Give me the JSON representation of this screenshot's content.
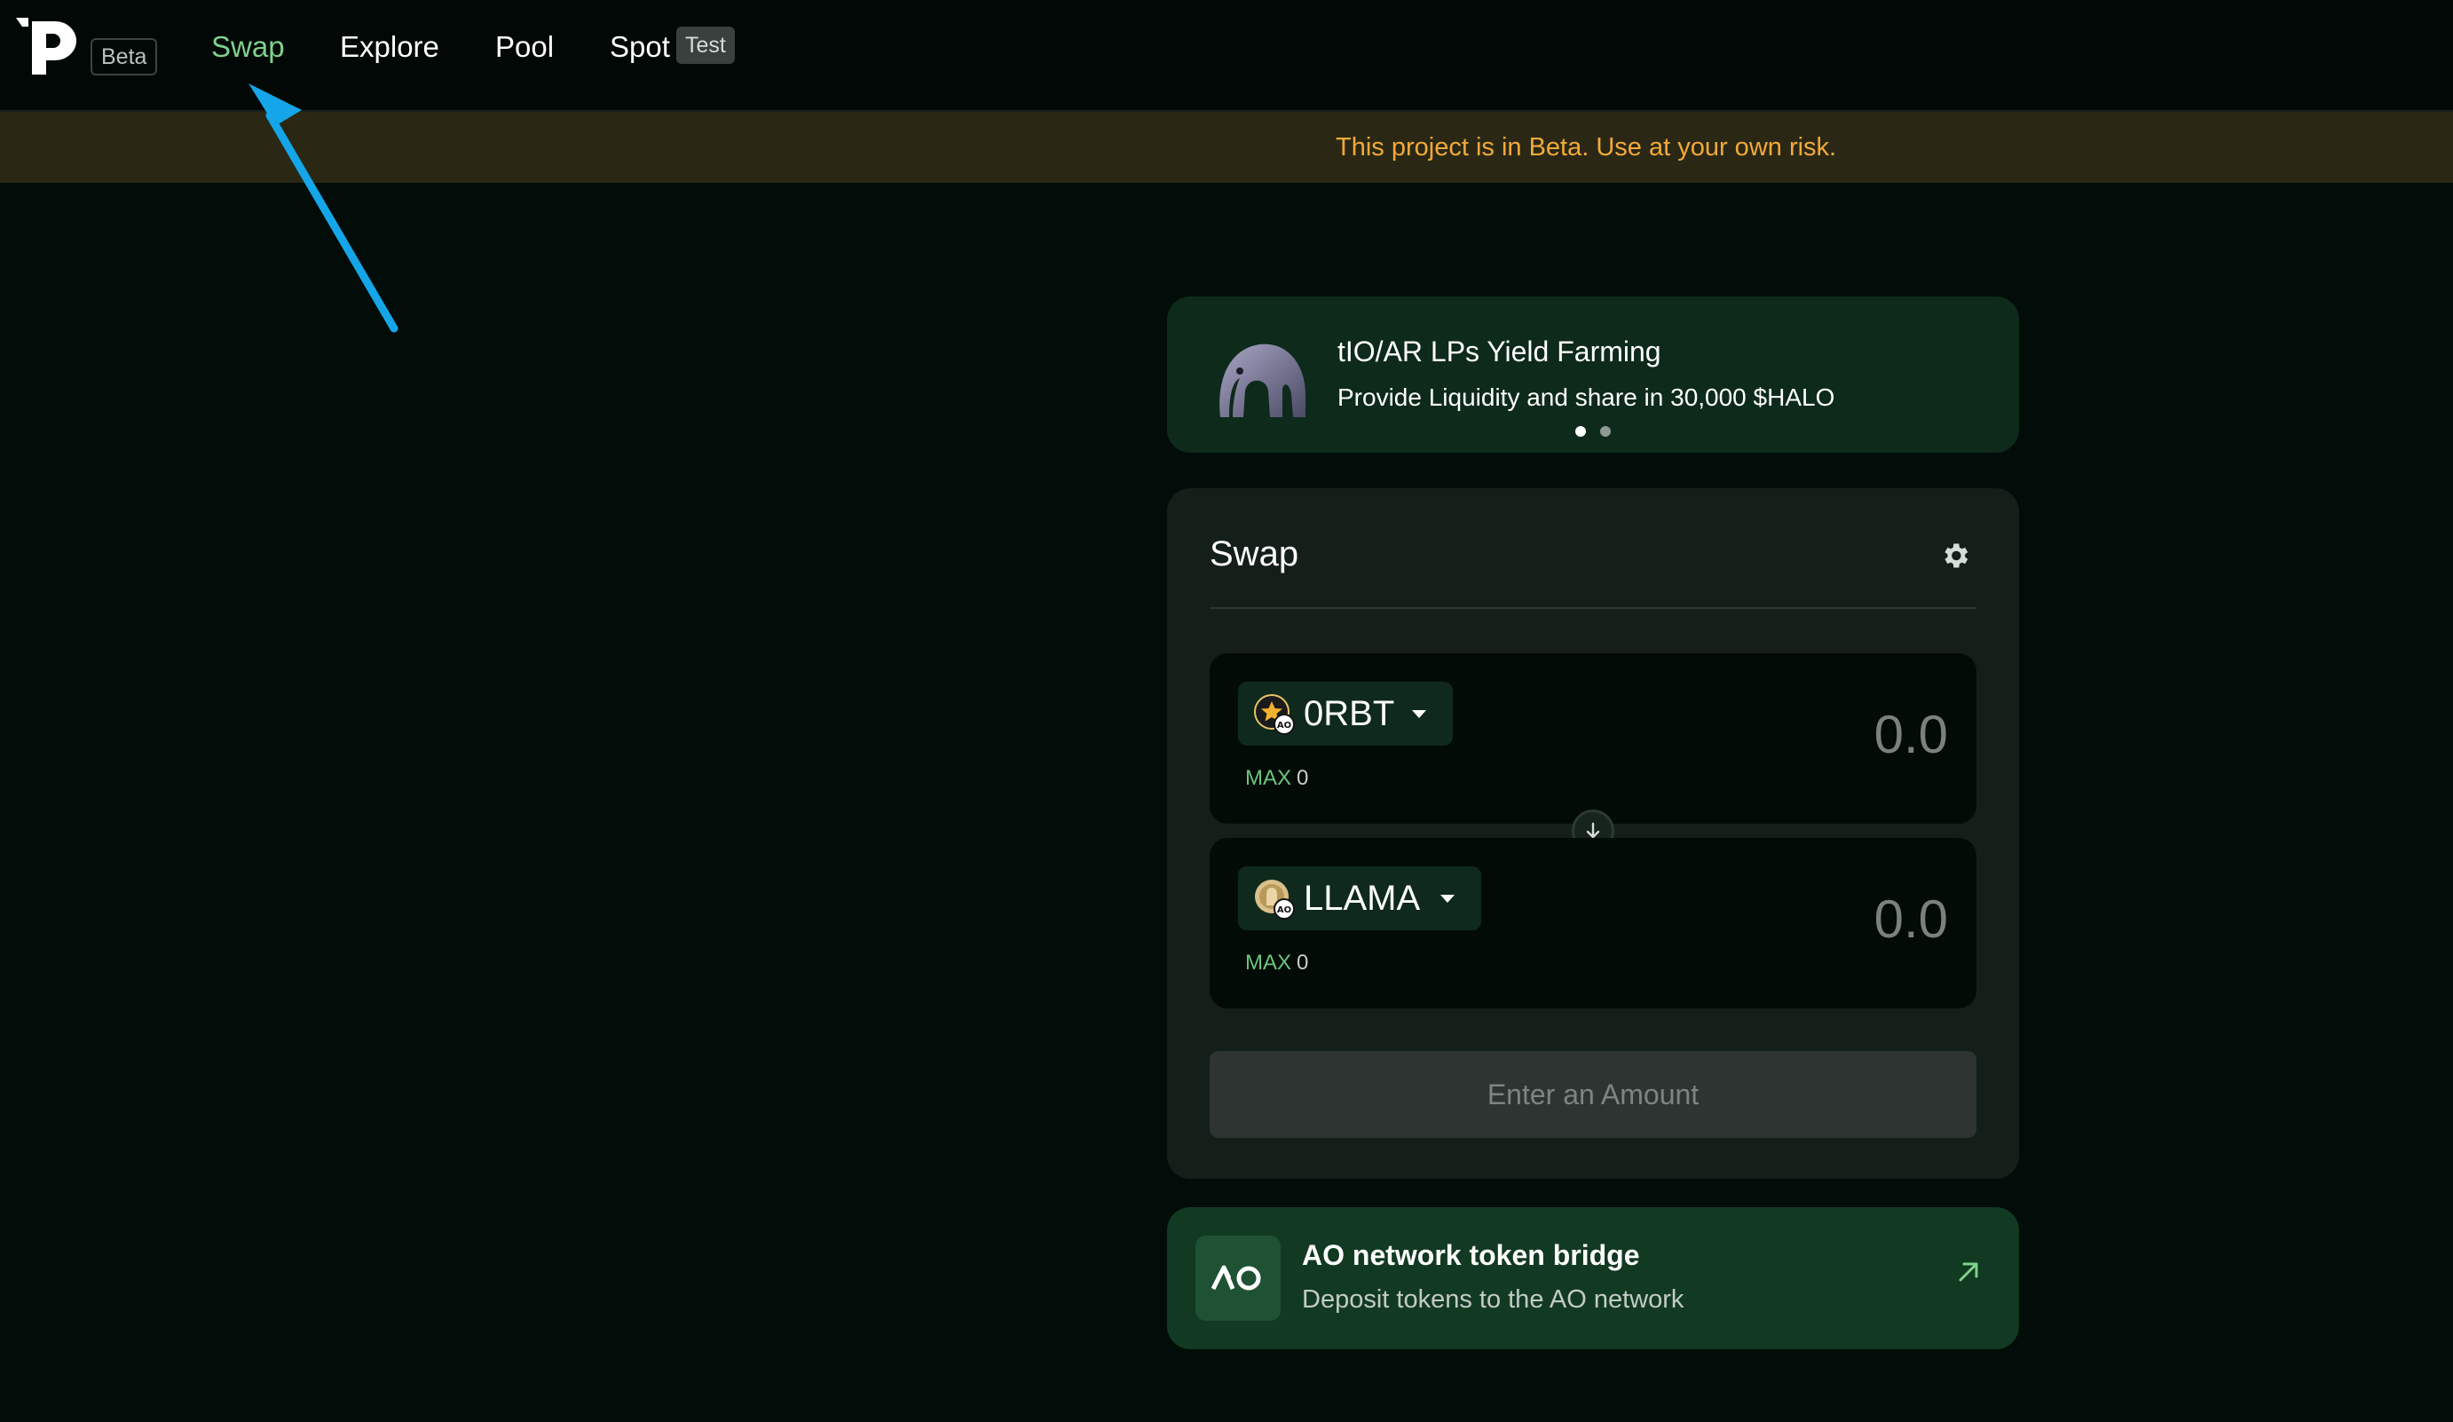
{
  "nav": {
    "logo": "p",
    "beta_badge": "Beta",
    "items": [
      {
        "label": "Swap",
        "active": true
      },
      {
        "label": "Explore",
        "active": false
      },
      {
        "label": "Pool",
        "active": false
      },
      {
        "label": "Spot",
        "active": false
      }
    ],
    "spot_badge": "Test"
  },
  "banner": {
    "text": "This project is in Beta. Use at your own risk."
  },
  "promo": {
    "title": "tIO/AR LPs Yield Farming",
    "subtitle": "Provide Liquidity and share in 30,000 $HALO",
    "carousel_active_index": 0,
    "carousel_count": 2
  },
  "swap": {
    "title": "Swap",
    "settings_icon": "gear-icon",
    "from": {
      "token": "0RBT",
      "max_label": "MAX",
      "max_value": "0",
      "amount": "0.0"
    },
    "to": {
      "token": "LLAMA",
      "max_label": "MAX",
      "max_value": "0",
      "amount": "0.0"
    },
    "flip_icon": "arrow-down-icon",
    "submit_label": "Enter an Amount"
  },
  "bridge": {
    "logo": "AO",
    "title": "AO network token bridge",
    "subtitle": "Deposit tokens to the AO network",
    "icon": "external-link-icon"
  },
  "colors": {
    "background": "#020c08",
    "accent_green": "#7fd18b",
    "warning_orange": "#f3a93a",
    "annotation_arrow": "#14a6e8"
  }
}
